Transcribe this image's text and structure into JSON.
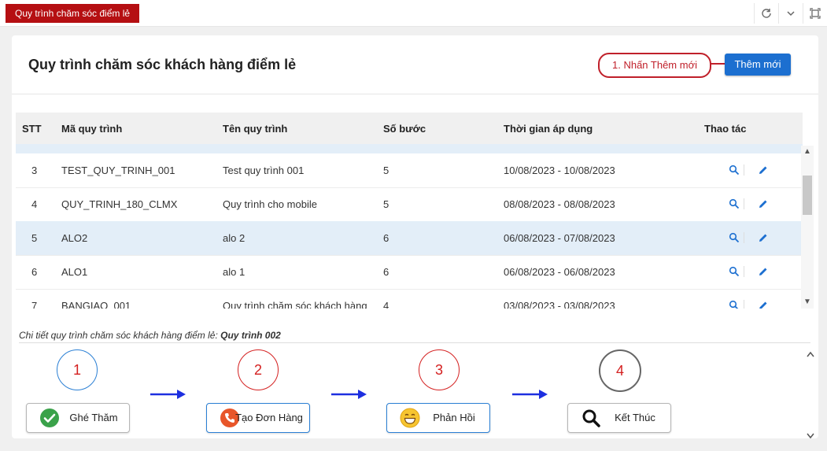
{
  "tab": {
    "label": "Quy trình chăm sóc điểm lẻ"
  },
  "page": {
    "title": "Quy trình chăm sóc khách hàng điểm lẻ",
    "callout": "1. Nhấn Thêm mới",
    "add_button": "Thêm mới"
  },
  "table": {
    "columns": [
      "STT",
      "Mã quy trình",
      "Tên quy trình",
      "Số bước",
      "Thời gian áp dụng",
      "Thao tác"
    ],
    "rows": [
      {
        "stt": "3",
        "code": "TEST_QUY_TRINH_001",
        "name": "Test quy trình 001",
        "steps": "5",
        "period": "10/08/2023 - 10/08/2023"
      },
      {
        "stt": "4",
        "code": "QUY_TRINH_180_CLMX",
        "name": "Quy trình cho mobile",
        "steps": "5",
        "period": "08/08/2023 - 08/08/2023"
      },
      {
        "stt": "5",
        "code": "ALO2",
        "name": "alo 2",
        "steps": "6",
        "period": "06/08/2023 - 07/08/2023"
      },
      {
        "stt": "6",
        "code": "ALO1",
        "name": "alo 1",
        "steps": "6",
        "period": "06/08/2023 - 06/08/2023"
      },
      {
        "stt": "7",
        "code": "BANGIAO_001",
        "name": "Quy trình chăm sóc khách hàng",
        "steps": "4",
        "period": "03/08/2023 - 03/08/2023"
      }
    ],
    "selected_row_index": 2
  },
  "detail": {
    "label": "Chi tiết quy trình chăm sóc khách hàng điểm lẻ:",
    "process_name": "Quy trình 002"
  },
  "steps": [
    {
      "number": "1",
      "label": "Ghé Thăm",
      "icon": "check-circle-icon",
      "circle_color": "#2a7fd4"
    },
    {
      "number": "2",
      "label": "Tạo Đơn Hàng",
      "icon": "phone-icon",
      "circle_color": "#d42020"
    },
    {
      "number": "3",
      "label": "Phản Hồi",
      "icon": "smile-icon",
      "circle_color": "#d42020"
    },
    {
      "number": "4",
      "label": "Kết Thúc",
      "icon": "search-icon",
      "circle_color": "#666666"
    }
  ],
  "colors": {
    "brand_red": "#b50f12",
    "primary_blue": "#1c6fd0",
    "selected_row": "#e3eef8"
  }
}
